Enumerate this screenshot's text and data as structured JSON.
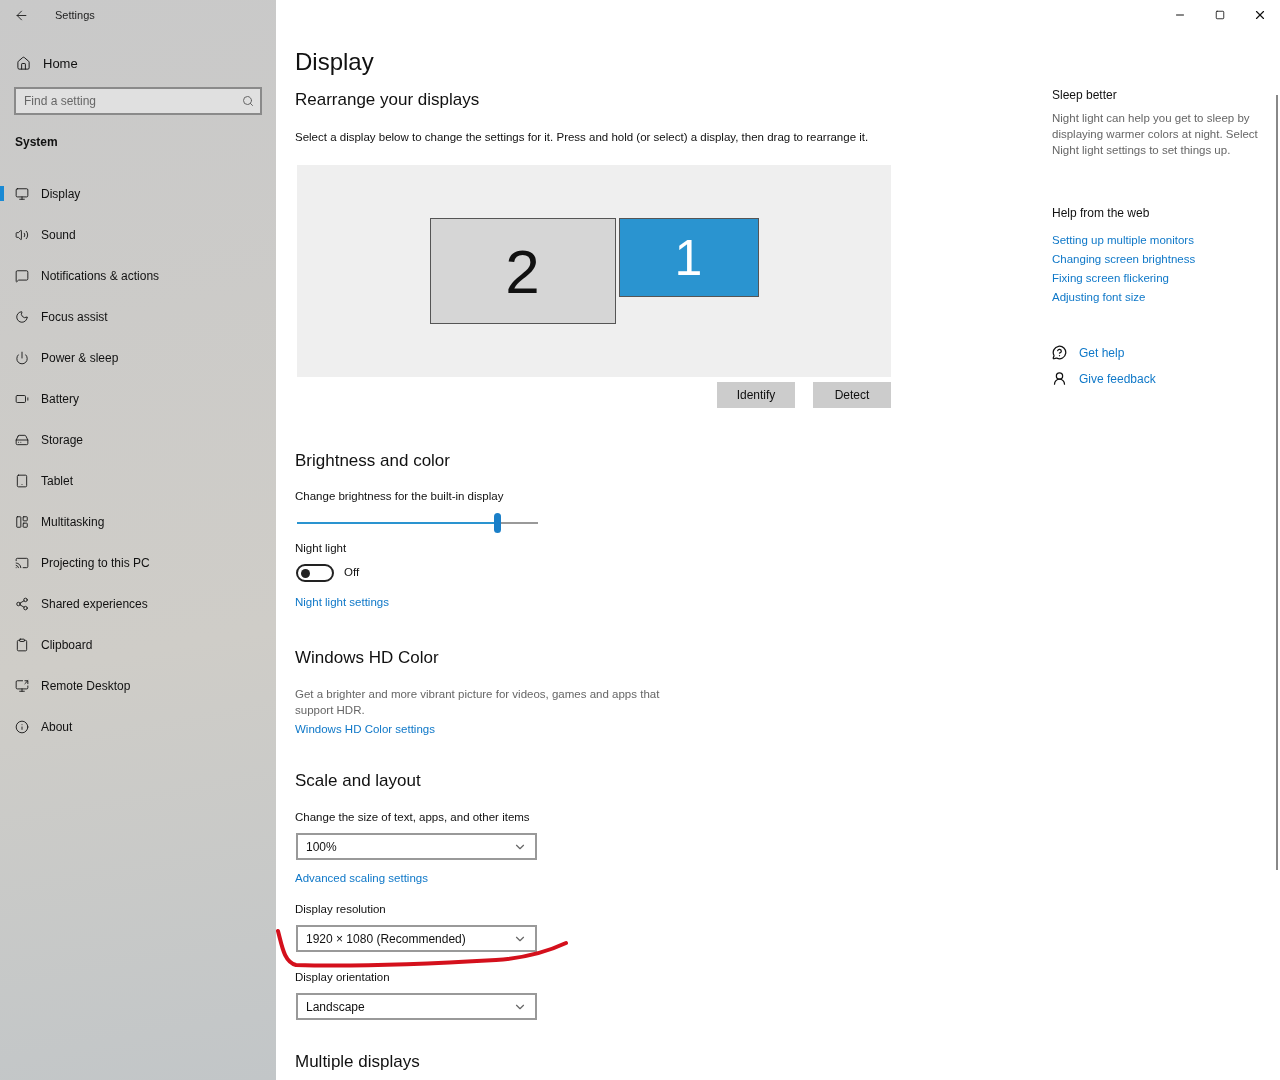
{
  "window": {
    "title": "Settings"
  },
  "sidebar": {
    "home": "Home",
    "search": {
      "placeholder": "Find a setting"
    },
    "section": "System",
    "items": [
      {
        "label": "Display",
        "selected": true
      },
      {
        "label": "Sound",
        "selected": false
      },
      {
        "label": "Notifications & actions",
        "selected": false
      },
      {
        "label": "Focus assist",
        "selected": false
      },
      {
        "label": "Power & sleep",
        "selected": false
      },
      {
        "label": "Battery",
        "selected": false
      },
      {
        "label": "Storage",
        "selected": false
      },
      {
        "label": "Tablet",
        "selected": false
      },
      {
        "label": "Multitasking",
        "selected": false
      },
      {
        "label": "Projecting to this PC",
        "selected": false
      },
      {
        "label": "Shared experiences",
        "selected": false
      },
      {
        "label": "Clipboard",
        "selected": false
      },
      {
        "label": "Remote Desktop",
        "selected": false
      },
      {
        "label": "About",
        "selected": false
      }
    ]
  },
  "page": {
    "title": "Display",
    "arrange": {
      "heading": "Rearrange your displays",
      "description": "Select a display below to change the settings for it. Press and hold (or select) a display, then drag to rearrange it.",
      "displays": [
        {
          "label": "2",
          "selected": false
        },
        {
          "label": "1",
          "selected": true
        }
      ],
      "buttons": [
        "Identify",
        "Detect"
      ]
    },
    "brightness": {
      "heading": "Brightness and color",
      "slider_label": "Change brightness for the built-in display",
      "level": 0.83,
      "night_light": {
        "label": "Night light",
        "on": false,
        "state_text": "Off"
      },
      "link": "Night light settings"
    },
    "hd_color": {
      "heading": "Windows HD Color",
      "description": "Get a brighter and more vibrant picture for videos, games and apps that support HDR.",
      "link": "Windows HD Color settings"
    },
    "scale": {
      "heading": "Scale and layout",
      "fields": [
        {
          "kind": "dropdown",
          "label": "Change the size of text, apps, and other items",
          "value": "100%"
        },
        {
          "kind": "link",
          "label": "Advanced scaling settings"
        },
        {
          "kind": "dropdown",
          "label": "Display resolution",
          "value": "1920 × 1080 (Recommended)"
        },
        {
          "kind": "dropdown",
          "label": "Display orientation",
          "value": "Landscape"
        }
      ]
    },
    "next_heading": "Multiple displays"
  },
  "aside": {
    "sleep": {
      "heading": "Sleep better",
      "text": "Night light can help you get to sleep by displaying warmer colors at night. Select Night light settings to set things up."
    },
    "help": {
      "heading": "Help from the web",
      "links": [
        "Setting up multiple monitors",
        "Changing screen brightness",
        "Fixing screen flickering",
        "Adjusting font size"
      ]
    },
    "actions": [
      "Get help",
      "Give feedback"
    ]
  }
}
